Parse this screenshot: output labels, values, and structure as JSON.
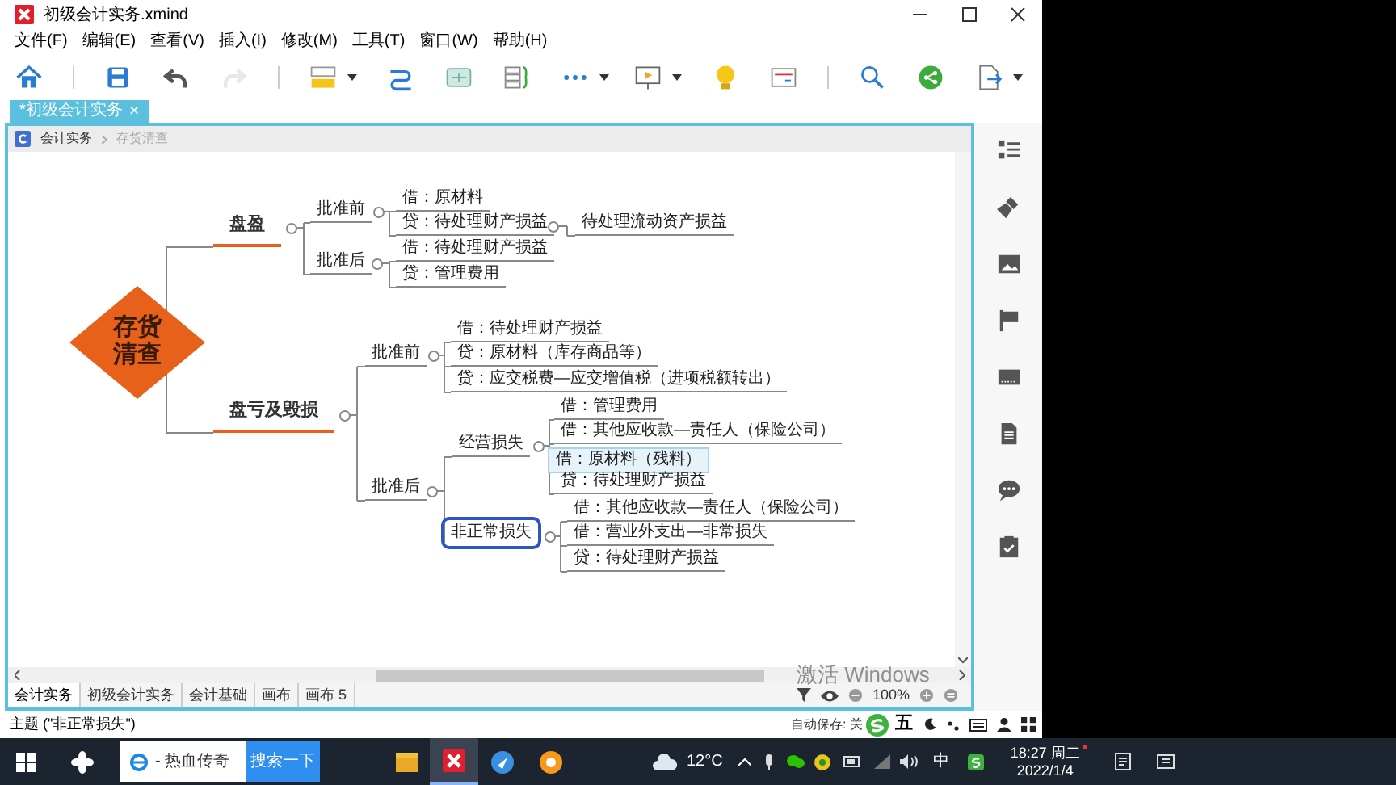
{
  "window": {
    "title": "初级会计实务.xmind"
  },
  "menu": [
    "文件(F)",
    "编辑(E)",
    "查看(V)",
    "插入(I)",
    "修改(M)",
    "工具(T)",
    "窗口(W)",
    "帮助(H)"
  ],
  "toolbar": [
    {
      "kind": "home",
      "disabled": false
    },
    {
      "kind": "save",
      "disabled": false
    },
    {
      "kind": "undo",
      "disabled": false
    },
    {
      "kind": "redo",
      "disabled": true
    },
    {
      "kind": "structure",
      "disabled": false
    },
    {
      "kind": "relationship",
      "disabled": false
    },
    {
      "kind": "boundary",
      "disabled": false
    },
    {
      "kind": "summary",
      "disabled": false
    },
    {
      "kind": "more",
      "disabled": false
    }
  ],
  "toolbar_right": [
    {
      "kind": "present",
      "disabled": false
    },
    {
      "kind": "idea",
      "disabled": false
    },
    {
      "kind": "pitch",
      "disabled": false
    },
    {
      "kind": "search",
      "disabled": false
    },
    {
      "kind": "share",
      "disabled": false
    },
    {
      "kind": "export",
      "disabled": false
    }
  ],
  "document_tab": {
    "label": "*初级会计实务",
    "close": "×"
  },
  "breadcrumb": [
    {
      "label": "会计实务",
      "current": false
    },
    {
      "label": "存货清查",
      "current": true
    }
  ],
  "map": {
    "root": {
      "text": "存货清查",
      "selected": false,
      "hovered": false,
      "children": [
        {
          "text": "盘盈",
          "selected": false,
          "hovered": false,
          "children": [
            {
              "text": "批准前",
              "selected": false,
              "hovered": false,
              "children": [
                {
                  "text": "借：原材料",
                  "selected": false,
                  "hovered": false
                },
                {
                  "text": "贷：待处理财产损益",
                  "selected": false,
                  "hovered": false,
                  "children": [
                    {
                      "text": "待处理流动资产损益",
                      "selected": false,
                      "hovered": false
                    }
                  ]
                }
              ]
            },
            {
              "text": "批准后",
              "selected": false,
              "hovered": false,
              "children": [
                {
                  "text": "借：待处理财产损益",
                  "selected": false,
                  "hovered": false
                },
                {
                  "text": "贷：管理费用",
                  "selected": false,
                  "hovered": false
                }
              ]
            }
          ]
        },
        {
          "text": "盘亏及毁损",
          "selected": false,
          "hovered": false,
          "children": [
            {
              "text": "批准前",
              "selected": false,
              "hovered": false,
              "children": [
                {
                  "text": "借：待处理财产损益",
                  "selected": false,
                  "hovered": false
                },
                {
                  "text": "贷：原材料（库存商品等）",
                  "selected": false,
                  "hovered": false
                },
                {
                  "text": "贷：应交税费—应交增值税（进项税额转出）",
                  "selected": false,
                  "hovered": false
                }
              ]
            },
            {
              "text": "批准后",
              "selected": false,
              "hovered": false,
              "children": [
                {
                  "text": "经营损失",
                  "selected": false,
                  "hovered": false,
                  "children": [
                    {
                      "text": "借：管理费用",
                      "selected": false,
                      "hovered": false
                    },
                    {
                      "text": "借：其他应收款—责任人（保险公司）",
                      "selected": false,
                      "hovered": false
                    },
                    {
                      "text": "借：原材料（残料）",
                      "selected": false,
                      "hovered": true
                    },
                    {
                      "text": "贷：待处理财产损益",
                      "selected": false,
                      "hovered": false
                    }
                  ]
                },
                {
                  "text": "非正常损失",
                  "selected": true,
                  "hovered": false,
                  "children": [
                    {
                      "text": "借：其他应收款—责任人（保险公司）",
                      "selected": false,
                      "hovered": false
                    },
                    {
                      "text": "借：营业外支出—非常损失",
                      "selected": false,
                      "hovered": false
                    },
                    {
                      "text": "贷：待处理财产损益",
                      "selected": false,
                      "hovered": false
                    }
                  ]
                }
              ]
            }
          ]
        }
      ]
    }
  },
  "sheet_tabs": [
    {
      "label": "会计实务",
      "selected": true
    },
    {
      "label": "初级会计实务",
      "selected": false
    },
    {
      "label": "会计基础",
      "selected": false
    },
    {
      "label": "画布",
      "selected": false
    },
    {
      "label": "画布 5",
      "selected": false
    }
  ],
  "zoom": {
    "value": "100%"
  },
  "status": {
    "topic": "主题 (\"非正常损失\")",
    "autosave": "自动保存: 关"
  },
  "ime_toolbar": {
    "mode": "五"
  },
  "activation_notice": {
    "text": "激活 Windows"
  },
  "taskbar": {
    "search_text": "- 热血传奇",
    "search_button": "搜索一下",
    "weather": "12°C",
    "input_lang": "中",
    "time": "18:27 周二",
    "date": "2022/1/4"
  }
}
